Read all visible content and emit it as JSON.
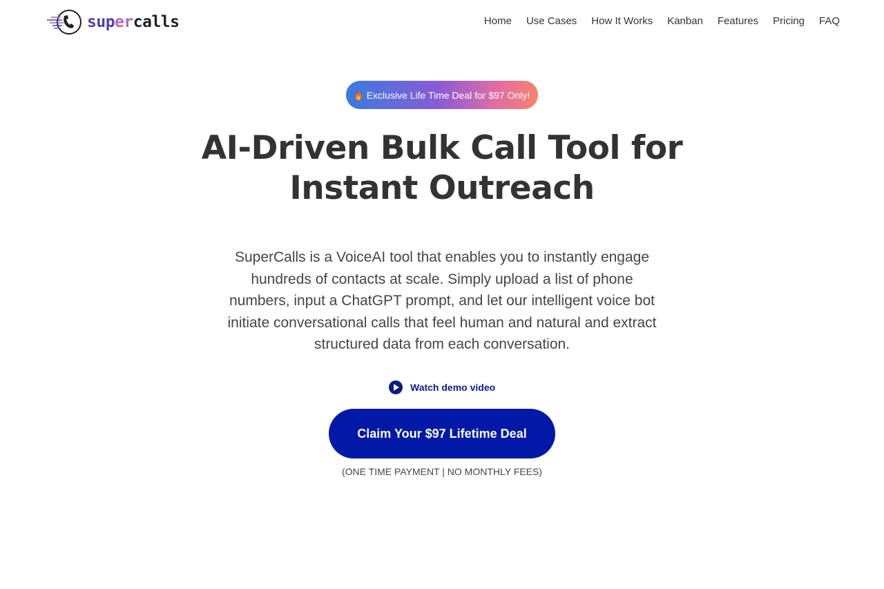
{
  "brand": {
    "logo_part1": "sup",
    "logo_part2": "er",
    "logo_part3": "calls"
  },
  "nav": {
    "items": [
      {
        "label": "Home"
      },
      {
        "label": "Use Cases"
      },
      {
        "label": "How It Works"
      },
      {
        "label": "Kanban"
      },
      {
        "label": "Features"
      },
      {
        "label": "Pricing"
      },
      {
        "label": "FAQ"
      }
    ]
  },
  "hero": {
    "badge": "Exclusive Life Time Deal for $97 Only!",
    "title_line1": "AI-Driven Bulk Call Tool for",
    "title_line2": "Instant Outreach",
    "description": "SuperCalls is a VoiceAI tool that enables you to instantly engage hundreds of contacts at scale. Simply upload a list of phone numbers, input a ChatGPT prompt, and let our intelligent voice bot initiate conversational calls that feel human and natural and extract structured data from each conversation.",
    "demo_label": "Watch demo video",
    "cta_label": "Claim Your $97 Lifetime Deal",
    "cta_note": "(ONE TIME PAYMENT | NO MONTHLY FEES)"
  },
  "colors": {
    "primary": "#0219a8",
    "link": "#0b1a88",
    "text": "#333333"
  },
  "icons": {
    "logo": "phone-speed-icon",
    "badge": "fire-icon",
    "demo": "play-circle-icon"
  }
}
